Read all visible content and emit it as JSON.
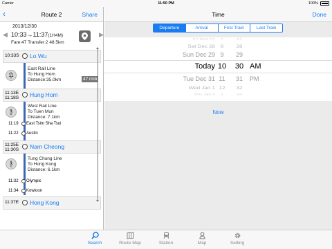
{
  "status_bar": {
    "carrier": "Carrier",
    "time": "11:50 PM",
    "battery": "100%"
  },
  "left_nav": {
    "back_icon": "chevron-left-icon",
    "title": "Route 2",
    "share_label": "Share"
  },
  "summary": {
    "date": "2013/12/30",
    "departure": "10:33",
    "arrival": "11:37",
    "duration": "(1H4M)",
    "fare_label": "Fare:47",
    "transfer_label": "Transfer:2",
    "distance_label": "48.5km"
  },
  "route": {
    "scroll_label": "47 rmb",
    "stations": [
      {
        "time": "10:33S",
        "time2": "",
        "name": "Lo Wu"
      },
      {
        "time": "11:13E",
        "time2": "11:18S",
        "name": "Hung Hom"
      },
      {
        "time": "11:25E",
        "time2": "11:30S",
        "name": "Nam Cheong"
      },
      {
        "time": "11:37E",
        "time2": "",
        "name": "Hong Kong"
      }
    ],
    "segments": [
      {
        "stops": "11",
        "line": "East Rail Line",
        "to": "To Hung Hom",
        "distance": "Distance:35.0km",
        "mini": []
      },
      {
        "stops": "3",
        "line": "West Rail Line",
        "to": "To Tuen Mun",
        "distance": "Distance: 7.1km",
        "mini": [
          {
            "time": "11:19",
            "name": "East Tsim Sha Tsui"
          },
          {
            "time": "11:22",
            "name": "Austin"
          }
        ]
      },
      {
        "stops": "3",
        "line": "Tung Chung Line",
        "to": "To Hong Kong",
        "distance": "Distance: 6.1km",
        "mini": [
          {
            "time": "11:32",
            "name": "Olympic"
          },
          {
            "time": "11:34",
            "name": "Kowloon"
          }
        ]
      }
    ]
  },
  "right_nav": {
    "title": "Time",
    "done_label": "Done"
  },
  "segment_control": {
    "options": [
      "Departure",
      "Arrival",
      "First Train",
      "Last Train"
    ],
    "selected": "Departure"
  },
  "picker": {
    "rows": [
      {
        "day": "Fri Dec 27",
        "hour": "7",
        "minute": "27",
        "ampm": ""
      },
      {
        "day": "Sat Dec 28",
        "hour": "8",
        "minute": "28",
        "ampm": ""
      },
      {
        "day": "Sun Dec 29",
        "hour": "9",
        "minute": "29",
        "ampm": ""
      },
      {
        "day": "Today",
        "hour": "10",
        "minute": "30",
        "ampm": "AM"
      },
      {
        "day": "Tue Dec 31",
        "hour": "11",
        "minute": "31",
        "ampm": "PM"
      },
      {
        "day": "Wed Jan 1",
        "hour": "12",
        "minute": "32",
        "ampm": ""
      },
      {
        "day": "Thu Jan 2",
        "hour": "1",
        "minute": "33",
        "ampm": ""
      }
    ]
  },
  "now_label": "Now",
  "tabbar": {
    "tabs": [
      {
        "label": "Search",
        "icon": "search-icon"
      },
      {
        "label": "Route Map",
        "icon": "map-book-icon"
      },
      {
        "label": "Station",
        "icon": "train-icon"
      },
      {
        "label": "Map",
        "icon": "map-pin-icon"
      },
      {
        "label": "Setting",
        "icon": "gear-icon"
      }
    ],
    "active": "Search"
  },
  "colors": {
    "accent": "#1a7cf0",
    "line_blue": "#3b67b3",
    "divider": "#b8b8b8"
  }
}
